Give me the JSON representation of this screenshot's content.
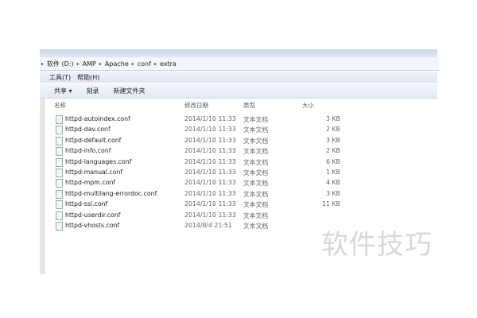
{
  "breadcrumb": [
    "软件 (D:)",
    "AMP",
    "Apache",
    "conf",
    "extra"
  ],
  "menu": [
    "工具(T)",
    "帮助(H)"
  ],
  "toolbar": {
    "share": "共享 ▾",
    "burn": "刻录",
    "new_folder": "新建文件夹"
  },
  "columns": {
    "name": "名称",
    "date": "修改日期",
    "type": "类型",
    "size": "大小"
  },
  "files": [
    {
      "name": "httpd-autoindex.conf",
      "date": "2014/1/10 11:33",
      "type": "文本文档",
      "size": "3 KB"
    },
    {
      "name": "httpd-dav.conf",
      "date": "2014/1/10 11:33",
      "type": "文本文档",
      "size": "2 KB"
    },
    {
      "name": "httpd-default.conf",
      "date": "2014/1/10 11:33",
      "type": "文本文档",
      "size": "3 KB"
    },
    {
      "name": "httpd-info.conf",
      "date": "2014/1/10 11:33",
      "type": "文本文档",
      "size": "2 KB"
    },
    {
      "name": "httpd-languages.conf",
      "date": "2014/1/10 11:33",
      "type": "文本文档",
      "size": "6 KB"
    },
    {
      "name": "httpd-manual.conf",
      "date": "2014/1/10 11:33",
      "type": "文本文档",
      "size": "1 KB"
    },
    {
      "name": "httpd-mpm.conf",
      "date": "2014/1/10 11:33",
      "type": "文本文档",
      "size": "4 KB"
    },
    {
      "name": "httpd-multilang-errordoc.conf",
      "date": "2014/1/10 11:33",
      "type": "文本文档",
      "size": "3 KB"
    },
    {
      "name": "httpd-ssl.conf",
      "date": "2014/1/10 11:33",
      "type": "文本文档",
      "size": "11 KB"
    },
    {
      "name": "httpd-userdir.conf",
      "date": "2014/1/10 11:33",
      "type": "文本文档",
      "size": ""
    },
    {
      "name": "httpd-vhosts.conf",
      "date": "2014/8/4 21:51",
      "type": "文本文档",
      "size": ""
    }
  ],
  "watermark": "软件技巧"
}
